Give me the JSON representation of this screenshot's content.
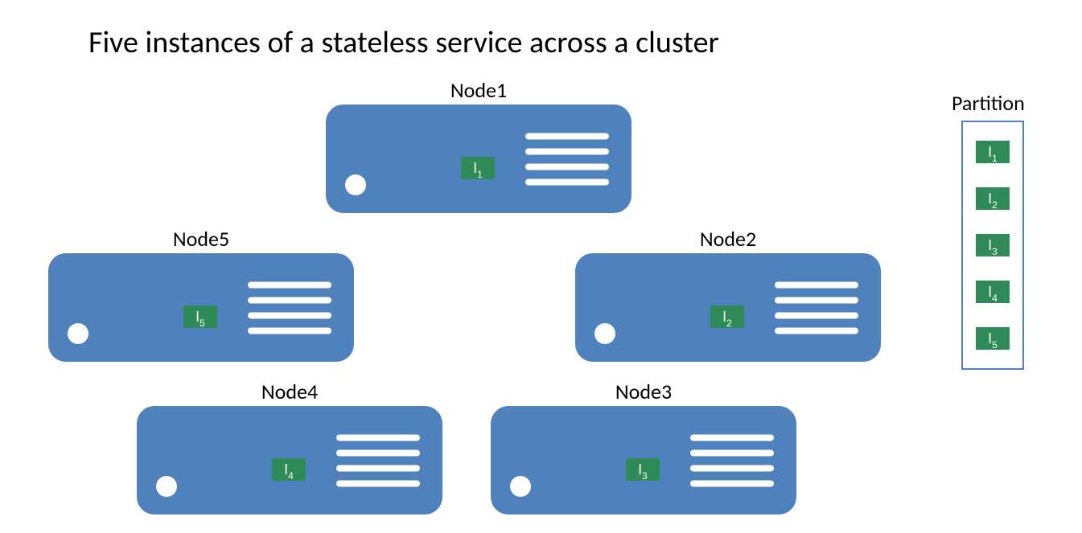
{
  "title": "Five instances of a stateless service across a cluster",
  "nodes": {
    "n1": {
      "label": "Node1",
      "instance": "I",
      "instance_sub": "1"
    },
    "n2": {
      "label": "Node2",
      "instance": "I",
      "instance_sub": "2"
    },
    "n3": {
      "label": "Node3",
      "instance": "I",
      "instance_sub": "3"
    },
    "n4": {
      "label": "Node4",
      "instance": "I",
      "instance_sub": "4"
    },
    "n5": {
      "label": "Node5",
      "instance": "I",
      "instance_sub": "5"
    }
  },
  "partition": {
    "title": "Partition",
    "items": [
      {
        "label": "I",
        "sub": "1"
      },
      {
        "label": "I",
        "sub": "2"
      },
      {
        "label": "I",
        "sub": "3"
      },
      {
        "label": "I",
        "sub": "4"
      },
      {
        "label": "I",
        "sub": "5"
      }
    ]
  }
}
